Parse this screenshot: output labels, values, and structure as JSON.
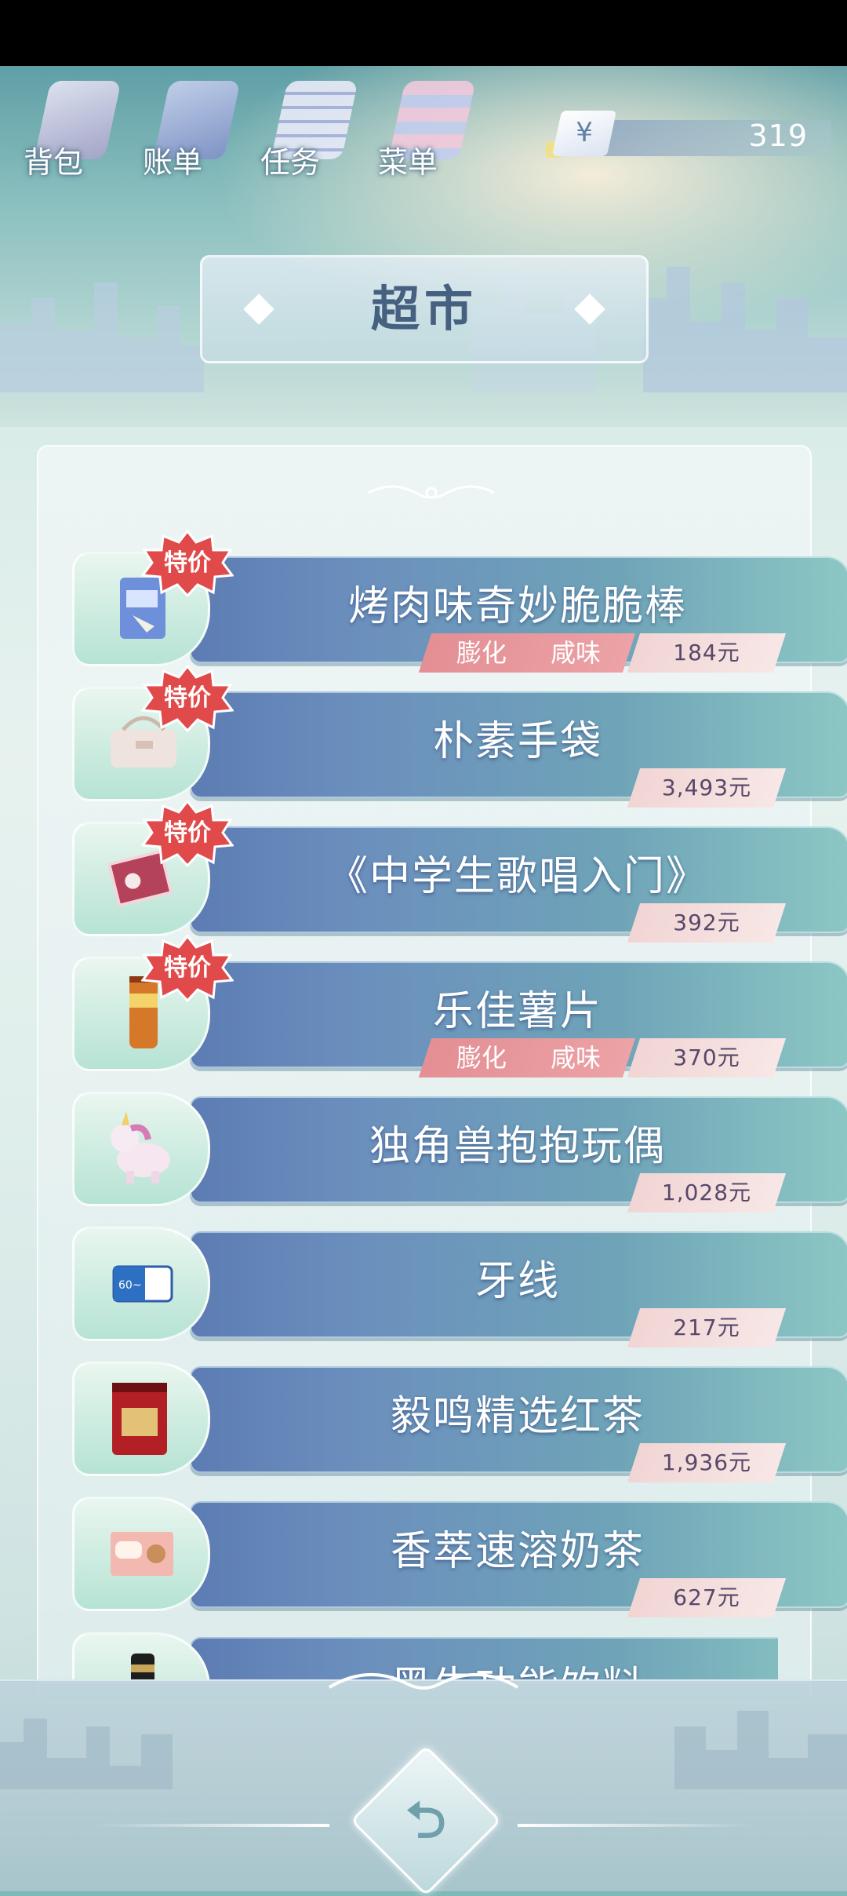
{
  "topbar": {
    "buttons": [
      {
        "label": "背包",
        "icon": "bag-icon"
      },
      {
        "label": "账单",
        "icon": "bill-icon"
      },
      {
        "label": "任务",
        "icon": "task-icon"
      },
      {
        "label": "菜单",
        "icon": "menu-icon"
      }
    ],
    "currency_symbol": "¥",
    "money": "319"
  },
  "title": "超市",
  "sale_badge": "特价",
  "items": [
    {
      "name": "烤肉味奇妙脆脆棒",
      "price": "184元",
      "tags": [
        "膨化",
        "咸味"
      ],
      "sale": true,
      "icon": "snack-bag-icon"
    },
    {
      "name": "朴素手袋",
      "price": "3,493元",
      "tags": [],
      "sale": true,
      "icon": "handbag-icon"
    },
    {
      "name": "《中学生歌唱入门》",
      "price": "392元",
      "tags": [],
      "sale": true,
      "icon": "book-icon"
    },
    {
      "name": "乐佳薯片",
      "price": "370元",
      "tags": [
        "膨化",
        "咸味"
      ],
      "sale": true,
      "icon": "chips-can-icon"
    },
    {
      "name": "独角兽抱抱玩偶",
      "price": "1,028元",
      "tags": [],
      "sale": false,
      "icon": "unicorn-plush-icon"
    },
    {
      "name": "牙线",
      "price": "217元",
      "tags": [],
      "sale": false,
      "icon": "floss-icon"
    },
    {
      "name": "毅鸣精选红茶",
      "price": "1,936元",
      "tags": [],
      "sale": false,
      "icon": "tea-can-icon"
    },
    {
      "name": "香萃速溶奶茶",
      "price": "627元",
      "tags": [],
      "sale": false,
      "icon": "milk-tea-box-icon"
    },
    {
      "name": "黑牛功能饮料",
      "price": "",
      "tags": [],
      "sale": false,
      "icon": "energy-drink-icon"
    }
  ],
  "back_button": {
    "icon": "back-arrow-icon"
  },
  "colors": {
    "row_start": "#5c7cb3",
    "row_end": "#8cc7c4",
    "price_tag": "#f1d5d4",
    "flavor_tag": "#e38f94",
    "sale_badge": "#e04a4a"
  }
}
